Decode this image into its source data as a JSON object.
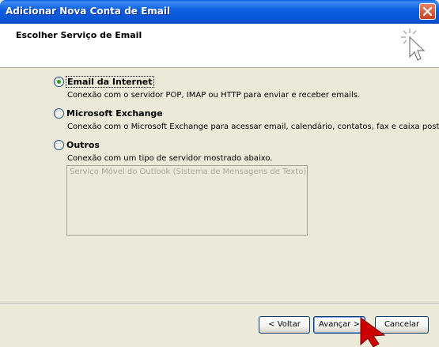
{
  "window": {
    "title": "Adicionar Nova Conta de Email"
  },
  "header": {
    "title": "Escolher Serviço de Email"
  },
  "options": [
    {
      "label": "Email da Internet",
      "selected": true,
      "description": "Conexão com o servidor POP, IMAP ou HTTP para enviar e receber emails."
    },
    {
      "label": "Microsoft Exchange",
      "selected": false,
      "description": "Conexão com o Microsoft Exchange para acessar email, calendário, contatos, fax e caixa postal."
    },
    {
      "label": "Outros",
      "selected": false,
      "description": "Conexão com um tipo de servidor mostrado abaixo."
    }
  ],
  "other_services": {
    "items": [
      "Serviço Móvel do Outlook (Sistema de Mensagens de Texto)"
    ]
  },
  "buttons": {
    "back": "< Voltar",
    "next": "Avançar >",
    "cancel": "Cancelar"
  },
  "colors": {
    "titlebar": "#0653D4",
    "dialog_bg": "#ECE9D8",
    "radio_dot": "#21A121",
    "cursor": "#CC0000"
  }
}
